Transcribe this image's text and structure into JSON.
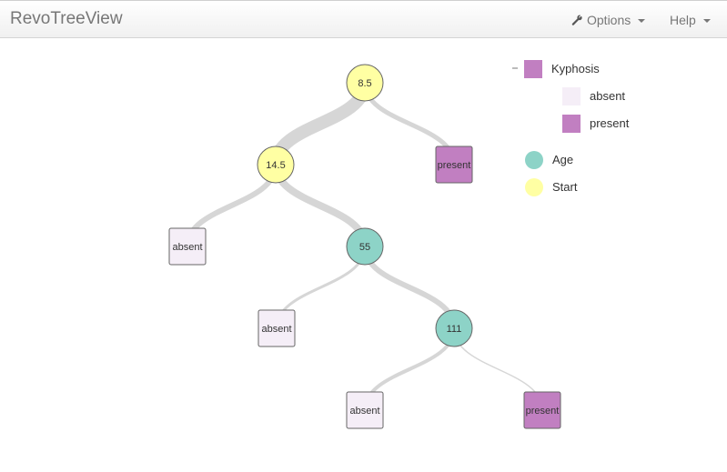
{
  "app": {
    "title": "RevoTreeView"
  },
  "nav": {
    "options_label": "Options",
    "help_label": "Help"
  },
  "legend": {
    "response_label": "Kyphosis",
    "response_color": "#c17fc1",
    "classes": [
      {
        "label": "absent",
        "color": "#f5eef7"
      },
      {
        "label": "present",
        "color": "#c17fc1"
      }
    ],
    "variables": [
      {
        "label": "Age",
        "color": "#8dd3c7"
      },
      {
        "label": "Start",
        "color": "#ffffa3"
      }
    ]
  },
  "tree": {
    "nodes": [
      {
        "id": "n1",
        "type": "split",
        "variable": "Start",
        "label": "8.5"
      },
      {
        "id": "n2",
        "type": "split",
        "variable": "Start",
        "label": "14.5",
        "parent": "n1"
      },
      {
        "id": "n3",
        "type": "leaf",
        "class": "present",
        "label": "present",
        "parent": "n1"
      },
      {
        "id": "n4",
        "type": "leaf",
        "class": "absent",
        "label": "absent",
        "parent": "n2"
      },
      {
        "id": "n5",
        "type": "split",
        "variable": "Age",
        "label": "55",
        "parent": "n2"
      },
      {
        "id": "n6",
        "type": "leaf",
        "class": "absent",
        "label": "absent",
        "parent": "n5"
      },
      {
        "id": "n7",
        "type": "split",
        "variable": "Age",
        "label": "111",
        "parent": "n5"
      },
      {
        "id": "n8",
        "type": "leaf",
        "class": "absent",
        "label": "absent",
        "parent": "n7"
      },
      {
        "id": "n9",
        "type": "leaf",
        "class": "present",
        "label": "present",
        "parent": "n7"
      }
    ]
  }
}
